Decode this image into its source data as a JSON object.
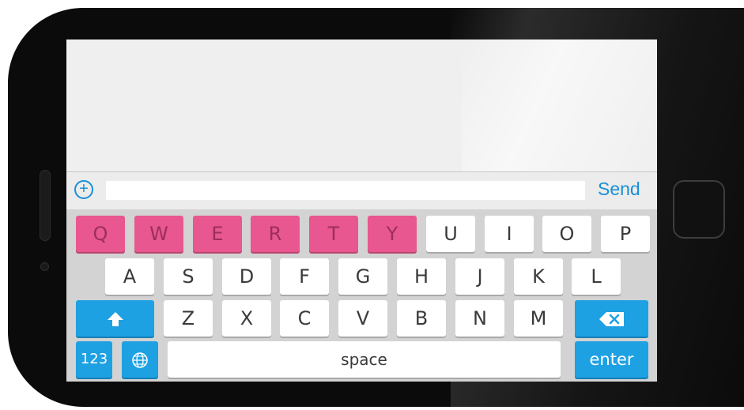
{
  "composer": {
    "add_icon": "plus-circle-icon",
    "input_value": "",
    "send_label": "Send"
  },
  "keyboard": {
    "row1": [
      "Q",
      "W",
      "E",
      "R",
      "T",
      "Y",
      "U",
      "I",
      "O",
      "P"
    ],
    "row2": [
      "A",
      "S",
      "D",
      "F",
      "G",
      "H",
      "J",
      "K",
      "L"
    ],
    "row3": [
      "Z",
      "X",
      "C",
      "V",
      "B",
      "N",
      "M"
    ],
    "shift_icon": "shift-arrow-icon",
    "backspace_icon": "backspace-icon",
    "numbers_label": "123",
    "globe_icon": "globe-icon",
    "space_label": "space",
    "enter_label": "enter",
    "highlight_color": "#e8578f",
    "accent_color": "#1ea1e3"
  }
}
